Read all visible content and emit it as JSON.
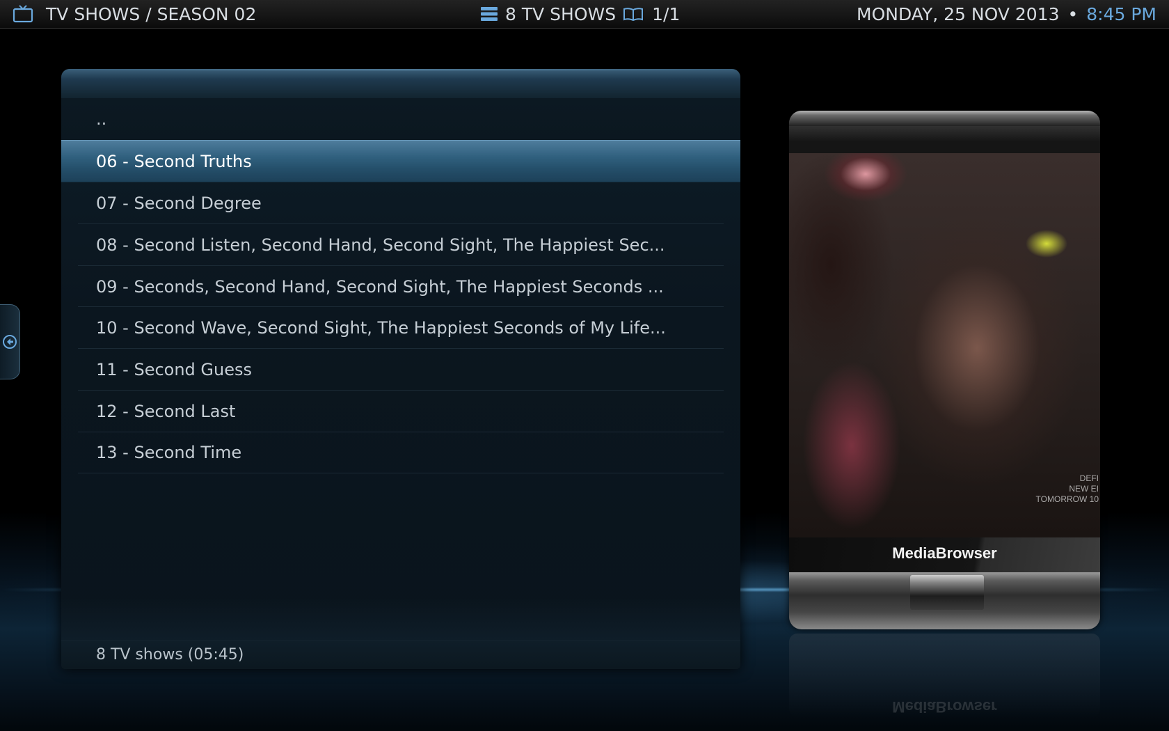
{
  "header": {
    "breadcrumb": "TV SHOWS / SEASON 02",
    "item_count": "8 TV SHOWS",
    "page": "1/1",
    "date": "MONDAY, 25 NOV 2013",
    "separator": "•",
    "time": "8:45 PM"
  },
  "list": {
    "parent_label": "..",
    "items": [
      {
        "label": "06 - Second Truths",
        "selected": true
      },
      {
        "label": "07 - Second Degree"
      },
      {
        "label": "08 - Second Listen, Second Hand, Second Sight, The Happiest Sec..."
      },
      {
        "label": "09 - Seconds, Second Hand, Second Sight, The Happiest Seconds ..."
      },
      {
        "label": "10 - Second Wave, Second Sight, The Happiest Seconds of My Life..."
      },
      {
        "label": "11 - Second Guess"
      },
      {
        "label": "12 - Second Last"
      },
      {
        "label": "13 - Second Time"
      }
    ],
    "footer": "8 TV shows (05:45)"
  },
  "preview": {
    "brand": "MediaBrowser",
    "screen_text": [
      "DEFI",
      "NEW EI",
      "TOMORROW 10"
    ]
  },
  "colors": {
    "accent": "#6aa9de",
    "selection": "#30607e"
  },
  "icons": {
    "header_left": "tv-icon",
    "header_count": "list-icon",
    "header_page": "book-icon",
    "side_tab": "back-arrow-icon"
  }
}
